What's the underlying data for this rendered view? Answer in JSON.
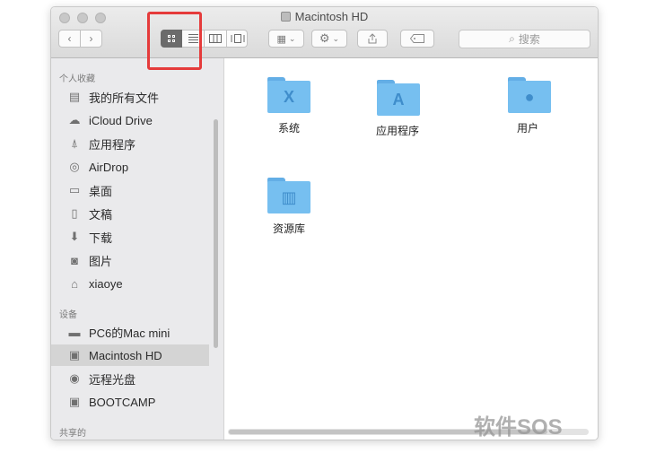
{
  "window": {
    "title": "Macintosh HD",
    "title_icon": "hard-drive-icon"
  },
  "toolbar": {
    "nav_back_icon": "chevron-left-icon",
    "nav_forward_icon": "chevron-right-icon",
    "view_modes": [
      {
        "name": "icon-view",
        "icon": "grid-icon",
        "selected": true
      },
      {
        "name": "list-view",
        "icon": "list-icon",
        "selected": false
      },
      {
        "name": "column-view",
        "icon": "columns-icon",
        "selected": false
      },
      {
        "name": "cover-flow-view",
        "icon": "coverflow-icon",
        "selected": false
      }
    ],
    "arrange_icon": "arrange-grid-icon",
    "action_icon": "gear-icon",
    "share_icon": "share-icon",
    "tag_icon": "tag-icon",
    "search_placeholder": "搜索",
    "search_icon": "search-icon"
  },
  "sidebar": {
    "sections": [
      {
        "label": "个人收藏",
        "items": [
          {
            "label": "我的所有文件",
            "icon": "all-files-icon"
          },
          {
            "label": "iCloud Drive",
            "icon": "cloud-icon"
          },
          {
            "label": "应用程序",
            "icon": "applications-icon"
          },
          {
            "label": "AirDrop",
            "icon": "airdrop-icon"
          },
          {
            "label": "桌面",
            "icon": "desktop-icon"
          },
          {
            "label": "文稿",
            "icon": "documents-icon"
          },
          {
            "label": "下载",
            "icon": "download-icon"
          },
          {
            "label": "图片",
            "icon": "camera-icon"
          },
          {
            "label": "xiaoye",
            "icon": "home-icon"
          }
        ]
      },
      {
        "label": "设备",
        "items": [
          {
            "label": "PC6的Mac mini",
            "icon": "mac-mini-icon"
          },
          {
            "label": "Macintosh HD",
            "icon": "hard-drive-icon",
            "selected": true
          },
          {
            "label": "远程光盘",
            "icon": "disc-icon"
          },
          {
            "label": "BOOTCAMP",
            "icon": "hard-drive-icon"
          }
        ]
      },
      {
        "label": "共享的",
        "items": []
      }
    ]
  },
  "content": {
    "folders": [
      {
        "label": "系统",
        "icon": "system-folder-icon",
        "glyph": "X"
      },
      {
        "label": "应用程序",
        "icon": "applications-folder-icon",
        "glyph": "A"
      },
      {
        "label": "用户",
        "icon": "users-folder-icon",
        "glyph": "●"
      },
      {
        "label": "资源库",
        "icon": "library-folder-icon",
        "glyph": "▥"
      }
    ]
  },
  "watermark": "软件SOS",
  "colors": {
    "highlight_box": "#e53b3b",
    "folder": "#76bff0",
    "selected_view_button": "#6b6b6b",
    "sidebar_bg": "#eaeaec"
  }
}
